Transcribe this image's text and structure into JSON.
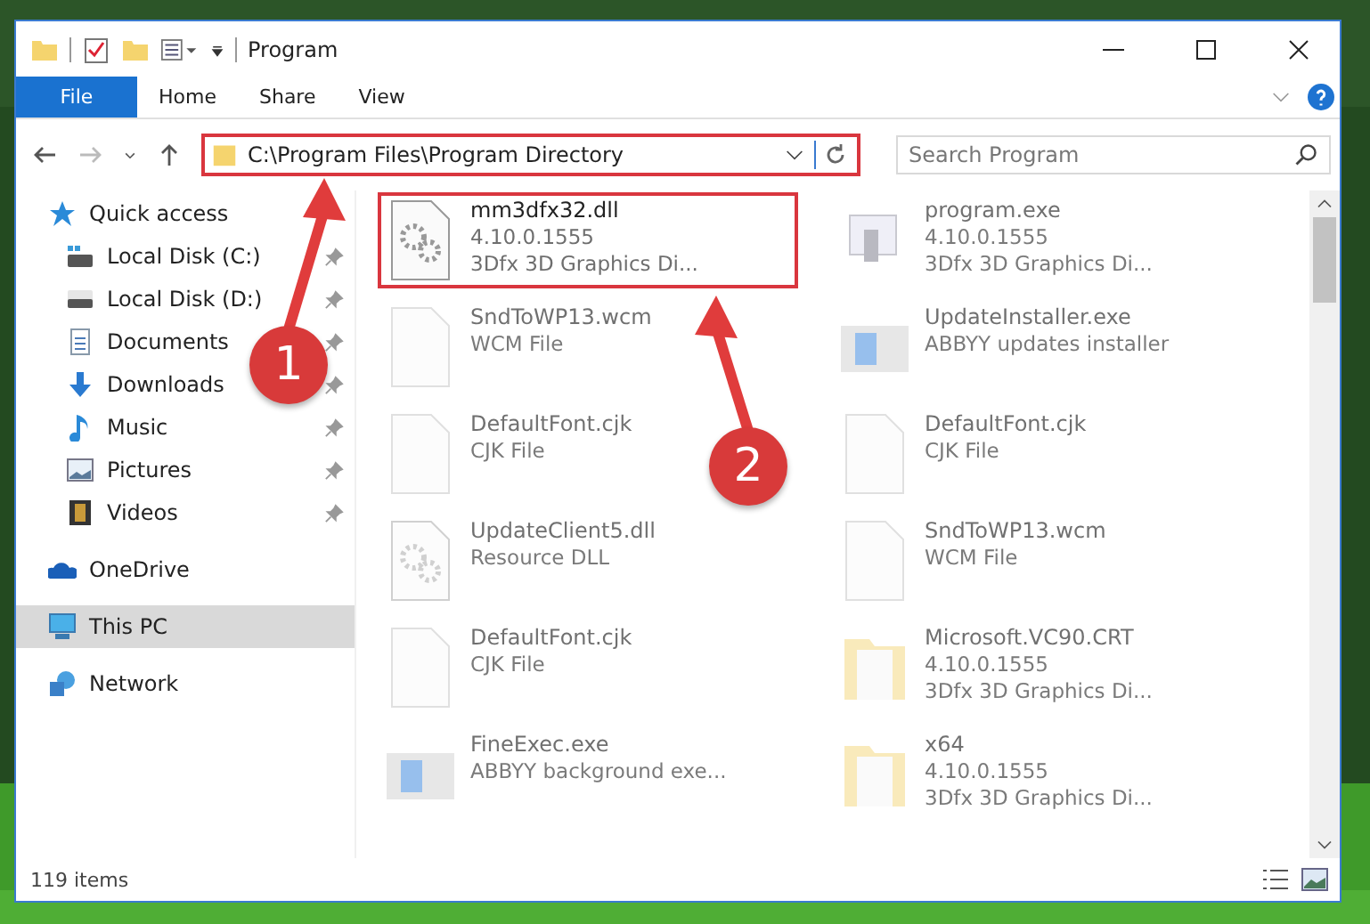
{
  "window": {
    "title": "Program"
  },
  "ribbon_tabs": [
    {
      "label": "File",
      "kind": "file-menu"
    },
    {
      "label": "Home",
      "kind": "tab"
    },
    {
      "label": "Share",
      "kind": "tab"
    },
    {
      "label": "View",
      "kind": "tab"
    }
  ],
  "address_bar": {
    "path": "C:\\Program Files\\Program Directory"
  },
  "search": {
    "placeholder": "Search Program"
  },
  "sidebar": {
    "items": [
      {
        "label": "Quick access",
        "kind": "star",
        "selected": false,
        "children": [
          {
            "label": "Local Disk (C:)",
            "kind": "drive-win",
            "pinned": true,
            "selected": false
          },
          {
            "label": "Local Disk (D:)",
            "kind": "drive",
            "pinned": true,
            "selected": false
          },
          {
            "label": "Documents",
            "kind": "document",
            "pinned": true,
            "selected": false
          },
          {
            "label": "Downloads",
            "kind": "download",
            "pinned": true,
            "selected": false
          },
          {
            "label": "Music",
            "kind": "music",
            "pinned": true,
            "selected": false
          },
          {
            "label": "Pictures",
            "kind": "pictures",
            "pinned": true,
            "selected": false
          },
          {
            "label": "Videos",
            "kind": "videos",
            "pinned": true,
            "selected": false
          }
        ]
      },
      {
        "label": "OneDrive",
        "kind": "cloud",
        "selected": false
      },
      {
        "label": "This PC",
        "kind": "pc",
        "selected": true
      },
      {
        "label": "Network",
        "kind": "network",
        "selected": false
      }
    ]
  },
  "files": [
    {
      "name": "mm3dfx32.dll",
      "lines": [
        "4.10.0.1555",
        "3Dfx 3D Graphics Di..."
      ],
      "kind": "gears",
      "dimmed": false,
      "highlighted": true
    },
    {
      "name": "program.exe",
      "lines": [
        "4.10.0.1555",
        "3Dfx 3D Graphics Di..."
      ],
      "kind": "program",
      "dimmed": true,
      "highlighted": false
    },
    {
      "name": "SndToWP13.wcm",
      "lines": [
        "WCM File"
      ],
      "kind": "blank",
      "dimmed": true,
      "highlighted": false
    },
    {
      "name": "UpdateInstaller.exe",
      "lines": [
        "ABBYY updates installer"
      ],
      "kind": "window",
      "dimmed": true,
      "highlighted": false
    },
    {
      "name": "DefaultFont.cjk",
      "lines": [
        "CJK File"
      ],
      "kind": "blank",
      "dimmed": true,
      "highlighted": false
    },
    {
      "name": "DefaultFont.cjk",
      "lines": [
        "CJK File"
      ],
      "kind": "blank",
      "dimmed": true,
      "highlighted": false
    },
    {
      "name": "UpdateClient5.dll",
      "lines": [
        "Resource DLL"
      ],
      "kind": "gears",
      "dimmed": true,
      "highlighted": false
    },
    {
      "name": "SndToWP13.wcm",
      "lines": [
        "WCM File"
      ],
      "kind": "blank",
      "dimmed": true,
      "highlighted": false
    },
    {
      "name": "DefaultFont.cjk",
      "lines": [
        "CJK File"
      ],
      "kind": "blank",
      "dimmed": true,
      "highlighted": false
    },
    {
      "name": "Microsoft.VC90.CRT",
      "lines": [
        "4.10.0.1555",
        "3Dfx 3D Graphics Di..."
      ],
      "kind": "folder",
      "dimmed": true,
      "highlighted": false
    },
    {
      "name": "FineExec.exe",
      "lines": [
        "ABBYY background exe..."
      ],
      "kind": "window",
      "dimmed": true,
      "highlighted": false
    },
    {
      "name": "x64",
      "lines": [
        "4.10.0.1555",
        "3Dfx 3D Graphics Di..."
      ],
      "kind": "folder",
      "dimmed": true,
      "highlighted": false
    }
  ],
  "status_bar": {
    "count": "119 items"
  },
  "annotations": [
    {
      "label": "1"
    },
    {
      "label": "2"
    }
  ]
}
